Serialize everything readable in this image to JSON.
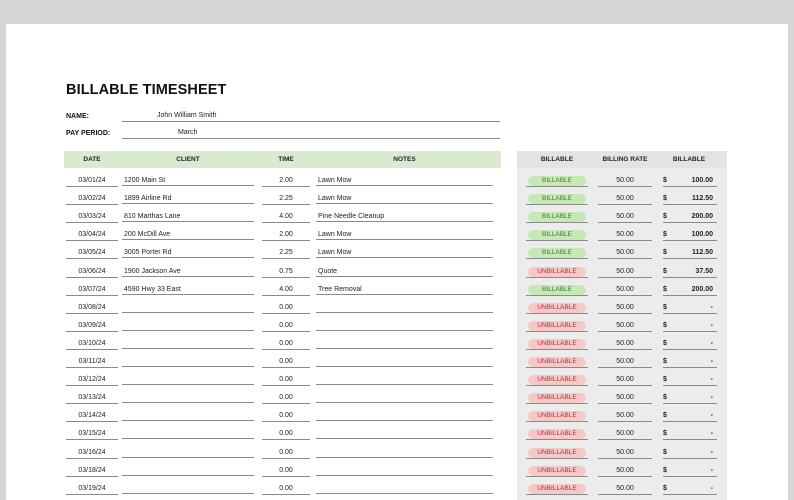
{
  "title": "BILLABLE TIMESHEET",
  "name_label": "NAME:",
  "name_value": "John William Smith",
  "period_label": "PAY PERIOD:",
  "period_value": "March",
  "headers": {
    "date": "DATE",
    "client": "CLIENT",
    "time": "TIME",
    "notes": "NOTES",
    "billable": "BILLABLE",
    "billing_rate": "BILLING RATE",
    "billable_amount": "BILLABLE"
  },
  "rows": [
    {
      "date": "03/01/24",
      "client": "1200 Main St",
      "time": "2.00",
      "notes": "Lawn Mow",
      "status": "BILLABLE",
      "rate": "50.00",
      "dollar": "$",
      "amount": "100.00"
    },
    {
      "date": "03/02/24",
      "client": "1899 Airline Rd",
      "time": "2.25",
      "notes": "Lawn Mow",
      "status": "BILLABLE",
      "rate": "50.00",
      "dollar": "$",
      "amount": "112.50"
    },
    {
      "date": "03/03/24",
      "client": "810 Marthas Lane",
      "time": "4.00",
      "notes": "Pine Needle Cleanup",
      "status": "BILLABLE",
      "rate": "50.00",
      "dollar": "$",
      "amount": "200.00"
    },
    {
      "date": "03/04/24",
      "client": "200 McDill Ave",
      "time": "2.00",
      "notes": "Lawn Mow",
      "status": "BILLABLE",
      "rate": "50.00",
      "dollar": "$",
      "amount": "100.00"
    },
    {
      "date": "03/05/24",
      "client": "3005 Porter Rd",
      "time": "2.25",
      "notes": "Lawn Mow",
      "status": "BILLABLE",
      "rate": "50.00",
      "dollar": "$",
      "amount": "112.50"
    },
    {
      "date": "03/06/24",
      "client": "1900 Jackson Ave",
      "time": "0.75",
      "notes": "Quote",
      "status": "UNBILLABLE",
      "rate": "50.00",
      "dollar": "$",
      "amount": "37.50"
    },
    {
      "date": "03/07/24",
      "client": "4590 Hwy 33 East",
      "time": "4.00",
      "notes": "Tree Removal",
      "status": "BILLABLE",
      "rate": "50.00",
      "dollar": "$",
      "amount": "200.00"
    },
    {
      "date": "03/08/24",
      "client": "",
      "time": "0.00",
      "notes": "",
      "status": "UNBILLABLE",
      "rate": "50.00",
      "dollar": "$",
      "amount": "-"
    },
    {
      "date": "03/09/24",
      "client": "",
      "time": "0.00",
      "notes": "",
      "status": "UNBILLABLE",
      "rate": "50.00",
      "dollar": "$",
      "amount": "-"
    },
    {
      "date": "03/10/24",
      "client": "",
      "time": "0.00",
      "notes": "",
      "status": "UNBILLABLE",
      "rate": "50.00",
      "dollar": "$",
      "amount": "-"
    },
    {
      "date": "03/11/24",
      "client": "",
      "time": "0.00",
      "notes": "",
      "status": "UNBILLABLE",
      "rate": "50.00",
      "dollar": "$",
      "amount": "-"
    },
    {
      "date": "03/12/24",
      "client": "",
      "time": "0.00",
      "notes": "",
      "status": "UNBILLABLE",
      "rate": "50.00",
      "dollar": "$",
      "amount": "-"
    },
    {
      "date": "03/13/24",
      "client": "",
      "time": "0.00",
      "notes": "",
      "status": "UNBILLABLE",
      "rate": "50.00",
      "dollar": "$",
      "amount": "-"
    },
    {
      "date": "03/14/24",
      "client": "",
      "time": "0.00",
      "notes": "",
      "status": "UNBILLABLE",
      "rate": "50.00",
      "dollar": "$",
      "amount": "-"
    },
    {
      "date": "03/15/24",
      "client": "",
      "time": "0.00",
      "notes": "",
      "status": "UNBILLABLE",
      "rate": "50.00",
      "dollar": "$",
      "amount": "-"
    },
    {
      "date": "03/16/24",
      "client": "",
      "time": "0.00",
      "notes": "",
      "status": "UNBILLABLE",
      "rate": "50.00",
      "dollar": "$",
      "amount": "-"
    },
    {
      "date": "03/18/24",
      "client": "",
      "time": "0.00",
      "notes": "",
      "status": "UNBILLABLE",
      "rate": "50.00",
      "dollar": "$",
      "amount": "-"
    },
    {
      "date": "03/19/24",
      "client": "",
      "time": "0.00",
      "notes": "",
      "status": "UNBILLABLE",
      "rate": "50.00",
      "dollar": "$",
      "amount": "-"
    }
  ]
}
